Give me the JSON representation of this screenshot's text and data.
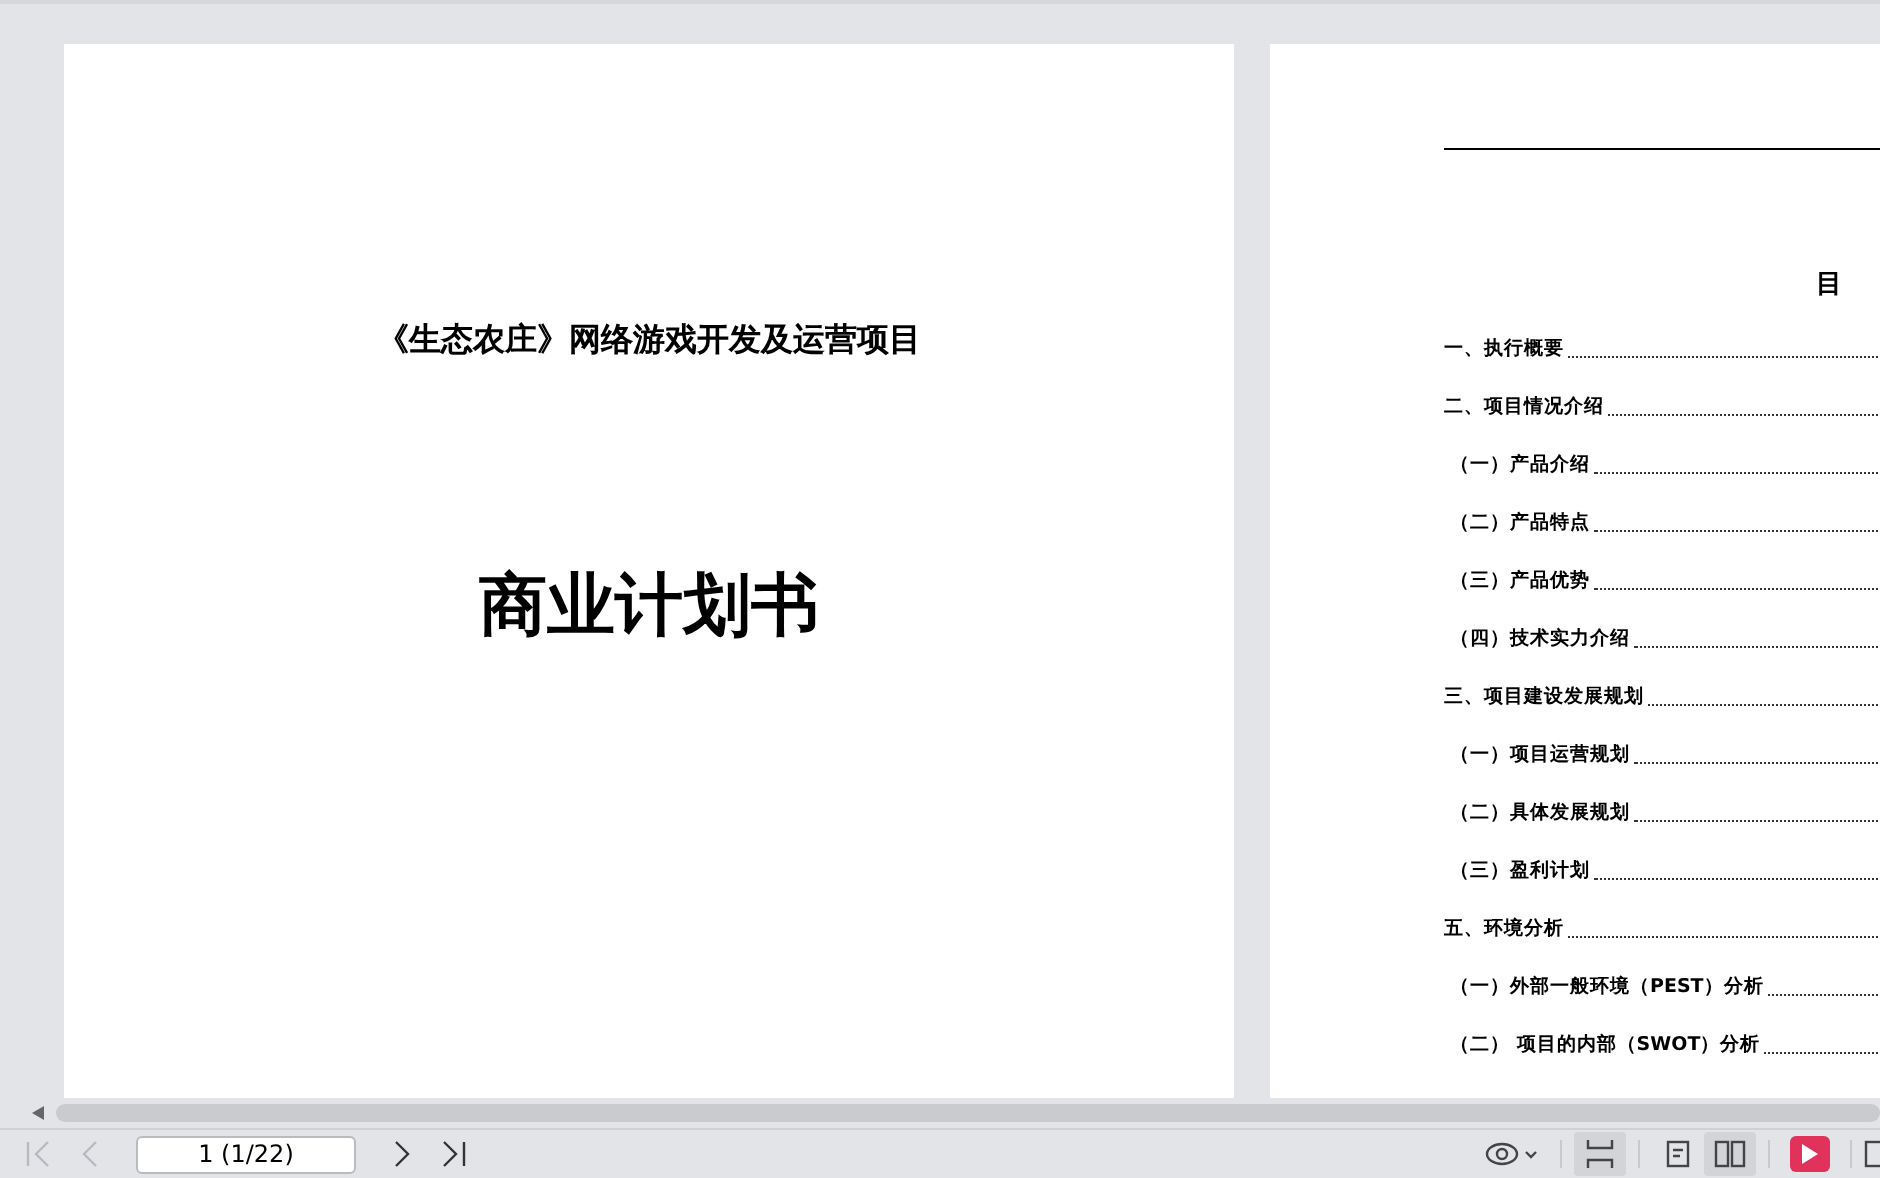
{
  "pages": [
    {
      "kind": "cover",
      "subtitle": "《生态农庄》网络游戏开发及运营项目",
      "title": "商业计划书"
    },
    {
      "kind": "toc",
      "heading": "目",
      "entries": [
        {
          "text": "一、执行概要"
        },
        {
          "text": "二、项目情况介绍",
          "children": [
            {
              "text": "（一）产品介绍"
            },
            {
              "text": "（二）产品特点"
            },
            {
              "text": "（三）产品优势"
            },
            {
              "text": "（四）技术实力介绍"
            }
          ]
        },
        {
          "text": "三、项目建设发展规划",
          "children": [
            {
              "text": "（一）项目运营规划"
            },
            {
              "text": "（二）具体发展规划"
            },
            {
              "text": "（三）盈利计划"
            }
          ]
        },
        {
          "text": "五、环境分析",
          "children": [
            {
              "text": "（一）外部一般环境（PEST）分析"
            },
            {
              "text": "（二）  项目的内部（SWOT）分析"
            }
          ]
        }
      ]
    }
  ],
  "toolbar": {
    "nav": [
      {
        "kind": "first",
        "disabled": true
      },
      {
        "kind": "prev",
        "disabled": true
      },
      {
        "kind": "page",
        "value": "1 (1/22)"
      },
      {
        "kind": "next",
        "disabled": false
      },
      {
        "kind": "last",
        "disabled": false
      }
    ],
    "views": [
      {
        "kind": "eye"
      },
      {
        "kind": "sep"
      },
      {
        "kind": "fitwidth",
        "selected": true
      },
      {
        "kind": "sep"
      },
      {
        "kind": "single",
        "selected": false
      },
      {
        "kind": "double",
        "selected": true
      },
      {
        "kind": "sep"
      },
      {
        "kind": "play"
      },
      {
        "kind": "sep"
      },
      {
        "kind": "cut"
      }
    ]
  }
}
